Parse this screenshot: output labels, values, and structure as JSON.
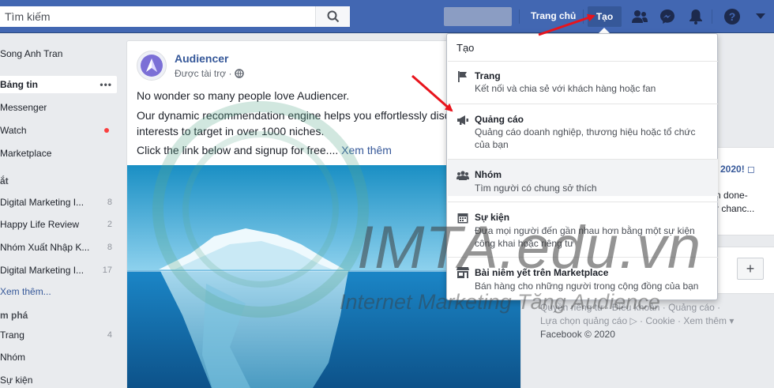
{
  "topbar": {
    "search_placeholder": "Tìm kiếm",
    "home_label": "Trang chủ",
    "create_label": "Tạo",
    "icons": [
      "search-icon",
      "friends-icon",
      "messenger-icon",
      "notifications-icon",
      "help-icon",
      "chevron-down-icon"
    ]
  },
  "sidebar": {
    "user_name": "Song Anh Tran",
    "items": [
      {
        "label": "Bảng tin",
        "selected": true
      },
      {
        "label": "Messenger"
      },
      {
        "label": "Watch"
      },
      {
        "label": "Marketplace"
      }
    ],
    "shortcuts_header": "ắt",
    "shortcuts": [
      {
        "label": "Digital Marketing I...",
        "count": "8"
      },
      {
        "label": "Happy Life Review",
        "count": "2"
      },
      {
        "label": "Nhóm Xuất Nhập K...",
        "count": "8"
      },
      {
        "label": "Digital Marketing I...",
        "count": "17"
      }
    ],
    "see_more": "Xem thêm...",
    "explore_header": "m phá",
    "explore": [
      {
        "label": "Trang",
        "count": "4"
      },
      {
        "label": "Nhóm"
      },
      {
        "label": "Sự kiện"
      }
    ]
  },
  "post": {
    "page_name": "Audiencer",
    "sponsored": "Được tài trợ ·",
    "line1": "No wonder so many people love Audiencer.",
    "line2": "Our dynamic recommendation engine helps you effortlessly disc",
    "line3": "interests to target in over 1000 niches.",
    "line4": "Click the link below and signup for free.... ",
    "see_more": "Xem thêm"
  },
  "dropdown": {
    "header": "Tạo",
    "items": [
      {
        "title": "Trang",
        "desc": "Kết nối và chia sẻ với khách hàng hoặc fan",
        "icon": "flag-icon"
      },
      {
        "title": "Quảng cáo",
        "desc": "Quảng cáo doanh nghiệp, thương hiệu hoặc tổ chức của bạn",
        "icon": "megaphone-icon"
      },
      {
        "title": "Nhóm",
        "desc": "Tìm người có chung sở thích",
        "icon": "group-icon",
        "active": true
      },
      {
        "title": "Sự kiện",
        "desc": "Đưa mọi người đến gần nhau hơn bằng một sự kiện công khai hoặc riêng tư",
        "icon": "calendar-icon"
      },
      {
        "title": "Bài niêm yết trên Marketplace",
        "desc": "Bán hàng cho những người trong cộng đồng của bạn",
        "icon": "shop-icon"
      }
    ]
  },
  "right": {
    "title": "r 2020! ◻",
    "line1": "n done-",
    "line2": "r chanc...",
    "plus": "+"
  },
  "footer": {
    "line1": "Quyền riêng tư · Điều khoản · Quảng cáo ·",
    "line2": "Lựa chọn quảng cáo ▷ · Cookie · Xem thêm ▾",
    "line3": "Facebook © 2020"
  },
  "watermark": {
    "main": "IMTA.edu.vn",
    "sub": "Internet Marketing Tăng Audience"
  },
  "colors": {
    "brand": "#4267b2",
    "link": "#365899",
    "arrow": "#e8141c",
    "notification_dot": "#fa3e3e"
  }
}
